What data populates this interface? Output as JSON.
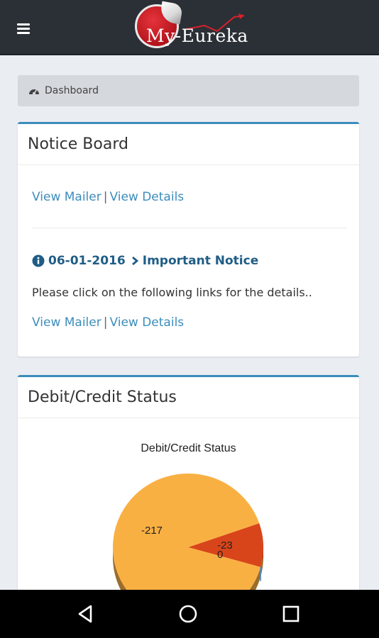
{
  "app": {
    "logo_text": "My-Eureka"
  },
  "breadcrumb": {
    "label": "Dashboard",
    "icon": "dashboard-icon"
  },
  "notice_board": {
    "title": "Notice Board",
    "links_top": {
      "mailer": "View Mailer",
      "separator": "|",
      "details": "View Details"
    },
    "notice": {
      "date": "06-01-2016",
      "title": "Important Notice",
      "text": "Please click on the following links for the details..",
      "mailer": "View Mailer",
      "separator": "|",
      "details": "View Details"
    }
  },
  "debit_credit": {
    "panel_title": "Debit/Credit Status"
  },
  "chart_data": {
    "type": "pie",
    "title": "Debit/Credit Status",
    "slices": [
      {
        "label": "-217",
        "value": -217,
        "color": "#f9b043"
      },
      {
        "label": "-23",
        "value": -23,
        "color": "#d9451a"
      },
      {
        "label": "0",
        "value": 0,
        "color": "#4d8ccf"
      }
    ],
    "colors": {
      "accent": "#3c8dbc",
      "link": "#3c8dbc",
      "notice_title": "#1f5d86"
    }
  },
  "navbar": {
    "back": "back-icon",
    "home": "home-icon",
    "recents": "recents-icon"
  }
}
